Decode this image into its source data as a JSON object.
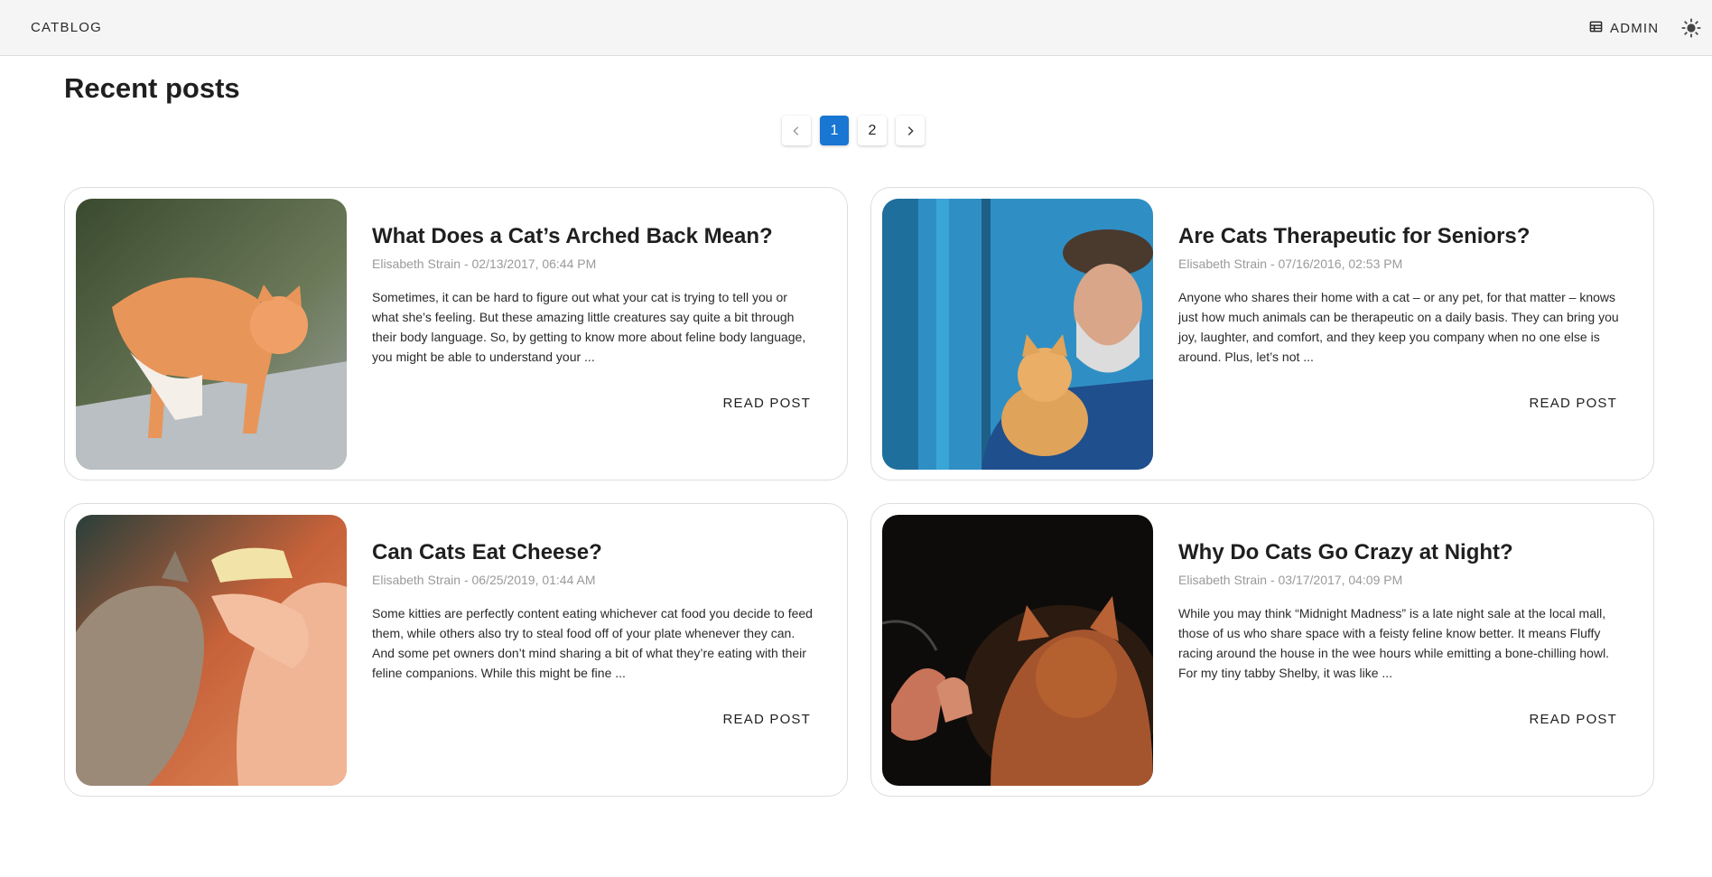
{
  "header": {
    "brand": "CATBLOG",
    "admin_label": "ADMIN",
    "admin_icon": "table-icon",
    "theme_icon": "sun-icon"
  },
  "main": {
    "title": "Recent posts",
    "pagination": {
      "prev_icon": "chevron-left-icon",
      "pages": [
        "1",
        "2"
      ],
      "current": "1",
      "next_icon": "chevron-right-icon",
      "accent": "#1976d2"
    },
    "posts": [
      {
        "title": "What Does a Cat’s Arched Back Mean?",
        "meta": "Elisabeth Strain - 02/13/2017, 06:44 PM",
        "excerpt": "Sometimes, it can be hard to figure out what your cat is trying to tell you or what she’s feeling. But these amazing little creatures say quite a bit through their body language. So, by getting to know more about feline body language, you might be able to understand your ...",
        "action": "READ POST"
      },
      {
        "title": "Are Cats Therapeutic for Seniors?",
        "meta": "Elisabeth Strain - 07/16/2016, 02:53 PM",
        "excerpt": "Anyone who shares their home with a cat – or any pet, for that matter – knows just how much animals can be therapeutic on a daily basis. They can bring you joy, laughter, and comfort, and they keep you company when no one else is around. Plus, let’s not ...",
        "action": "READ POST"
      },
      {
        "title": "Can Cats Eat Cheese?",
        "meta": "Elisabeth Strain - 06/25/2019, 01:44 AM",
        "excerpt": "Some kitties are perfectly content eating whichever cat food you decide to feed them, while others also try to steal food off of your plate whenever they can. And some pet owners don’t mind sharing a bit of what they’re eating with their feline companions. While this might be fine ...",
        "action": "READ POST"
      },
      {
        "title": "Why Do Cats Go Crazy at Night?",
        "meta": "Elisabeth Strain - 03/17/2017, 04:09 PM",
        "excerpt": "While you may think “Midnight Madness” is a late night sale at the local mall, those of us who share space with a feisty feline know better. It means Fluffy racing around the house in the wee hours while emitting a bone-chilling howl. For my tiny tabby Shelby, it was like ...",
        "action": "READ POST"
      }
    ]
  }
}
